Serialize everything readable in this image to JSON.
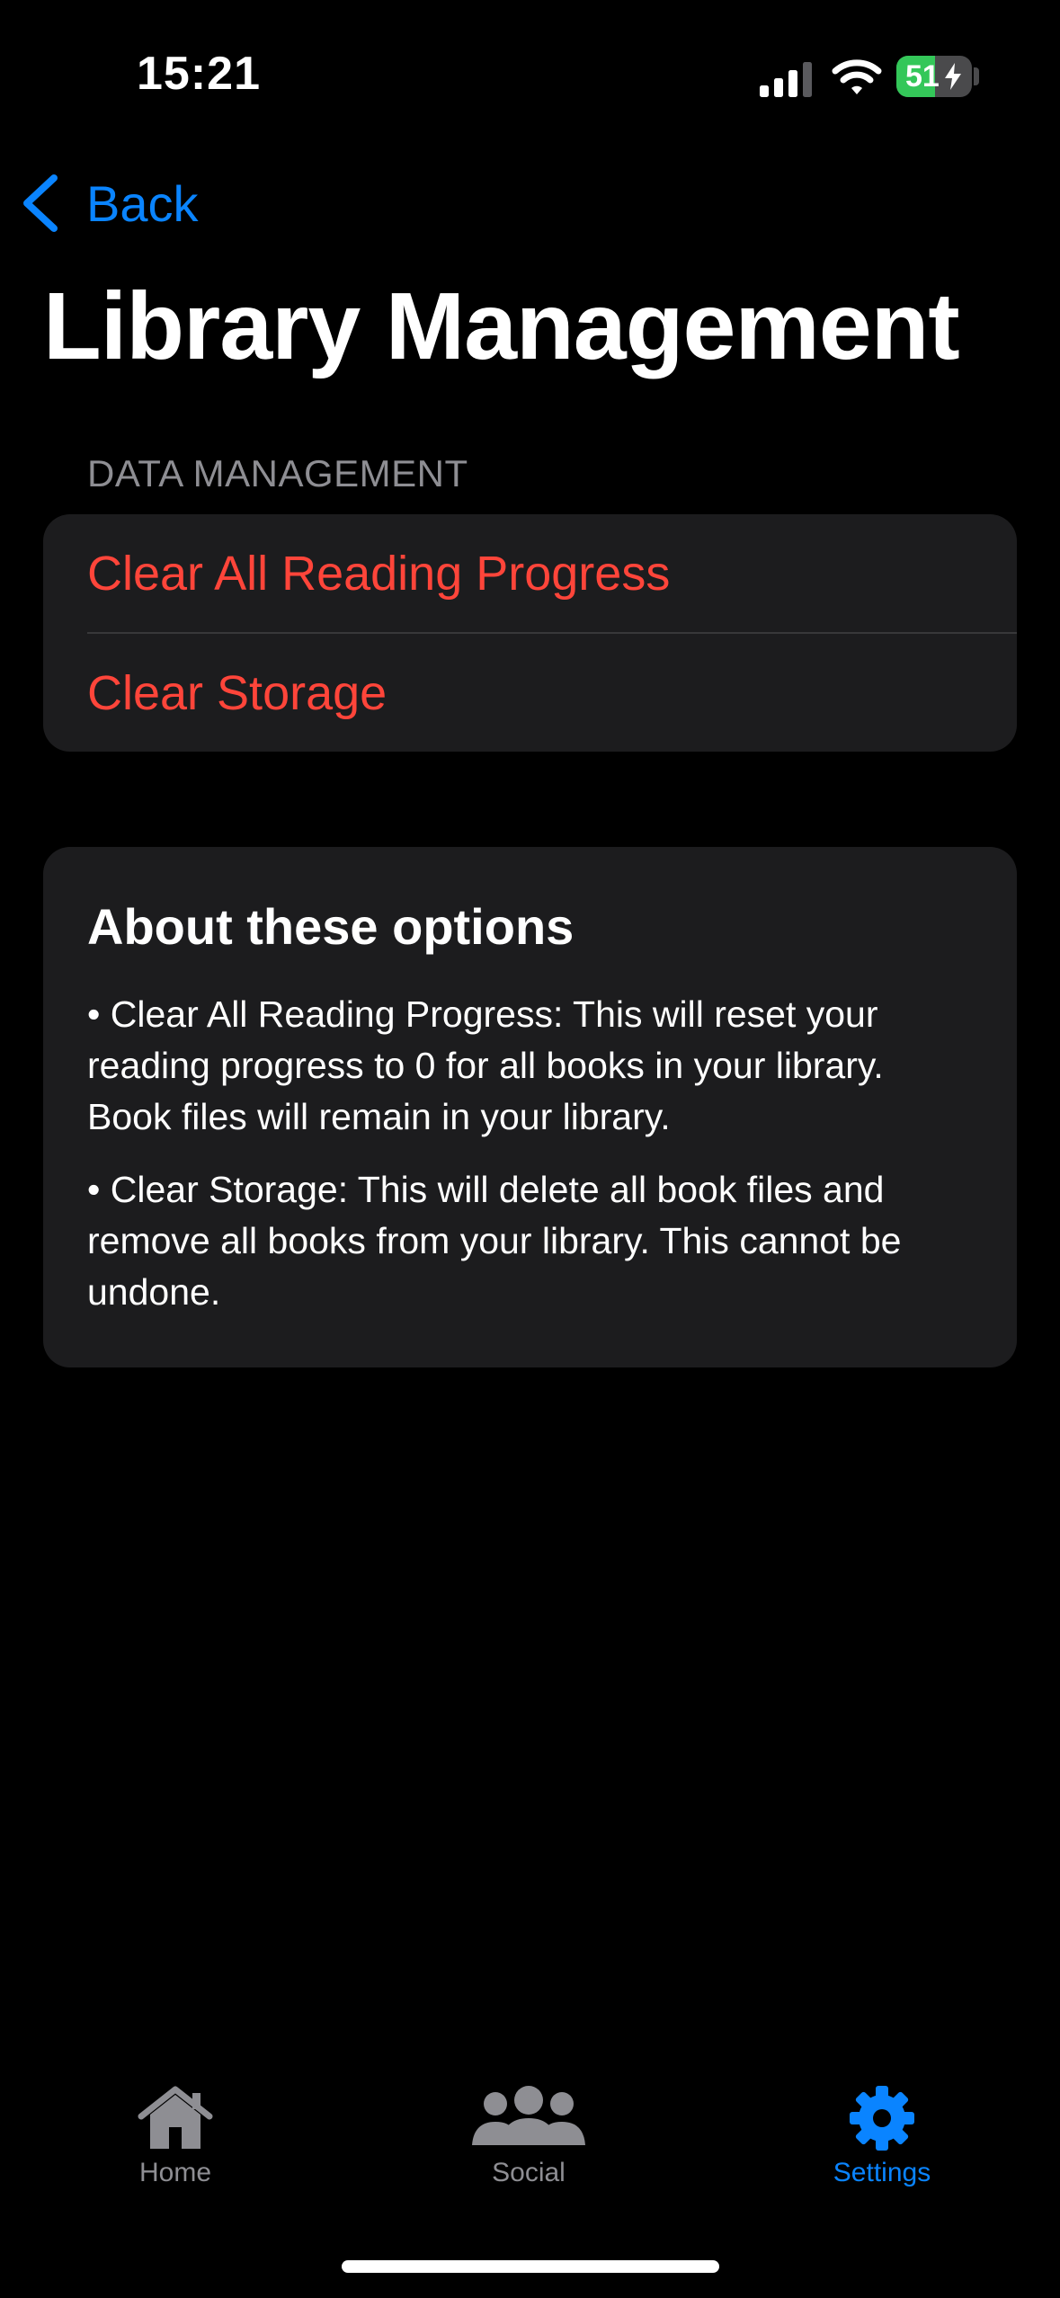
{
  "status_bar": {
    "time": "15:21",
    "battery_level": "51",
    "battery_fraction": 0.51,
    "signal_icon": "cellular-signal-icon",
    "wifi_icon": "wifi-icon"
  },
  "nav": {
    "back_label": "Back",
    "back_icon": "chevron-left-icon"
  },
  "page": {
    "title": "Library Management"
  },
  "data_management": {
    "header": "DATA MANAGEMENT",
    "actions": [
      {
        "label": "Clear All Reading Progress"
      },
      {
        "label": "Clear Storage"
      }
    ]
  },
  "about": {
    "title": "About these options",
    "paragraphs": [
      "• Clear All Reading Progress: This will reset your reading progress to 0 for all books in your library. Book files will remain in your library.",
      "• Clear Storage: This will delete all book files and remove all books from your library. This cannot be undone."
    ]
  },
  "tab_bar": {
    "tabs": [
      {
        "label": "Home",
        "icon": "house-icon",
        "active": false
      },
      {
        "label": "Social",
        "icon": "people-icon",
        "active": false
      },
      {
        "label": "Settings",
        "icon": "gear-icon",
        "active": true
      }
    ]
  },
  "colors": {
    "background": "#000000",
    "card": "#1c1c1e",
    "accent": "#0a84ff",
    "destructive": "#ff453a",
    "secondary_text": "#8e8e93",
    "battery_green": "#34c759"
  }
}
